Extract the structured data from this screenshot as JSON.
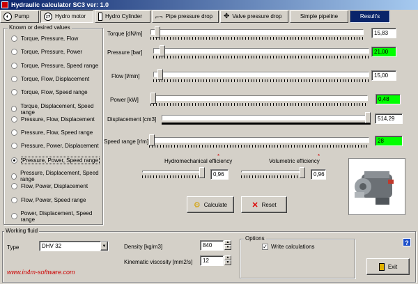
{
  "window": {
    "title": "Hydraulic calculator SC3  ver: 1.0"
  },
  "tabs": [
    {
      "label": "Pump"
    },
    {
      "label": "Hydro motor"
    },
    {
      "label": "Hydro Cylinder"
    },
    {
      "label": "Pipe pressure drop"
    },
    {
      "label": "Valve pressure drop"
    },
    {
      "label": "Simple pipeline"
    },
    {
      "label": "Result's"
    }
  ],
  "known_values": {
    "title": "Known or desired values",
    "options": [
      "Torque, Pressure, Flow",
      "Torque, Pressure, Power",
      "Torque, Pressure, Speed range",
      "Torque, Flow, Displacement",
      "Torque, Flow, Speed range",
      "Torque, Displacement, Speed range",
      "Pressure, Flow, Displacement",
      "Pressure, Flow, Speed range",
      "Pressure, Power, Displacement",
      "Pressure, Power, Speed range",
      "Pressure, Displacement, Speed range",
      "Flow, Power, Displacement",
      "Flow, Power, Speed range",
      "Power, Displacement, Speed range"
    ],
    "selected_index": 9
  },
  "params": {
    "torque": {
      "label": "Torque [dN/m]",
      "value": "15,83",
      "highlight": false,
      "level": 0.02
    },
    "pressure": {
      "label": "Pressure [bar]",
      "value": "21,00",
      "highlight": true,
      "level": 0.03
    },
    "flow": {
      "label": "Flow [l/min]",
      "value": "15,00",
      "highlight": false,
      "level": 0.02
    },
    "power": {
      "label": "Power [kW]",
      "value": "0,48",
      "highlight": true,
      "level": 0.0
    },
    "displacement": {
      "label": "Displacement [cm3]",
      "value": "514,29",
      "highlight": false,
      "level": 1.0
    },
    "speed": {
      "label": "Speed range [r/m]",
      "value": "28",
      "highlight": true,
      "level": 0.0
    }
  },
  "efficiency": {
    "hydromechanical": {
      "label": "Hydromechanical efficiency",
      "value": "0,96"
    },
    "volumetric": {
      "label": "Volumetric efficiency",
      "value": "0,96"
    },
    "marker": "*"
  },
  "buttons": {
    "calculate": "Calculate",
    "reset": "Reset",
    "exit": "Exit",
    "help": "?"
  },
  "fluid": {
    "title": "Working fluid",
    "type_label": "Type",
    "type_value": "DHV 32",
    "density_label": "Density [kg/m3]",
    "density_value": "840",
    "viscosity_label": "Kinematic viscosity [mm2/s]",
    "viscosity_value": "12"
  },
  "options": {
    "title": "Options",
    "write_calc_label": "Write calculations",
    "write_calc_checked": true
  },
  "website": "www.in4m-software.com",
  "colors": {
    "highlight": "#00ff00",
    "accent_tab": "#0a246a",
    "website": "#cc0000"
  }
}
